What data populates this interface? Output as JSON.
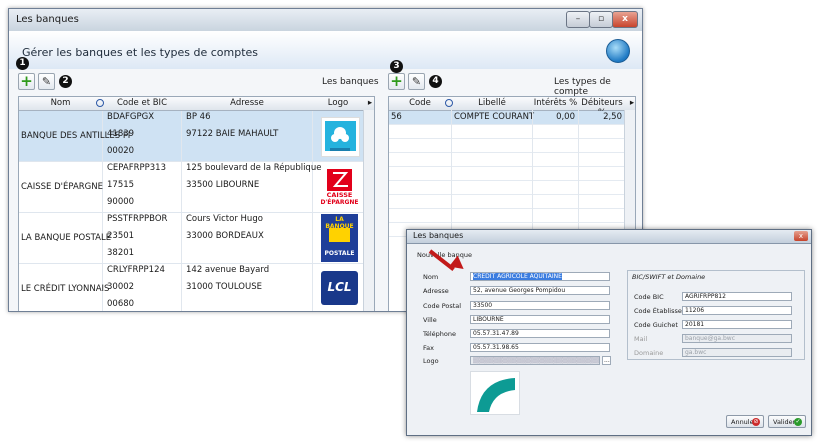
{
  "window": {
    "title": "Les banques",
    "header_title": "Gérer les banques et les types de comptes"
  },
  "titlebar_buttons": {
    "minimize": "–",
    "maximize": "▫",
    "close": "x"
  },
  "markers": [
    "1",
    "2",
    "3",
    "4"
  ],
  "banks": {
    "section_label": "Les banques",
    "columns": {
      "nom": "Nom",
      "code": "Code et BIC",
      "adresse": "Adresse",
      "logo": "Logo"
    },
    "rows": [
      {
        "nom": "BANQUE DES ANTILLES FI",
        "code": [
          "BDAFGPGX",
          "41839",
          "00020"
        ],
        "adresse": [
          "BP 46",
          "97122  BAIE MAHAULT"
        ],
        "logo": "BDAF"
      },
      {
        "nom": "CAISSE D'ÉPARGNE",
        "code": [
          "CEPAFRPP313",
          "17515",
          "90000"
        ],
        "adresse": [
          "125 boulevard de la République",
          "33500  LIBOURNE"
        ],
        "logo_text": [
          "CAISSE",
          "D'ÉPARGNE"
        ]
      },
      {
        "nom": "LA BANQUE POSTALE",
        "code": [
          "PSSTFRPPBOR",
          "23501",
          "38201"
        ],
        "adresse": [
          "Cours Victor Hugo",
          "33000  BORDEAUX"
        ],
        "logo_text": [
          "LA BANQUE",
          "POSTALE"
        ]
      },
      {
        "nom": "LE CRÉDIT LYONNAIS",
        "code": [
          "CRLYFRPP124",
          "30002",
          "00680"
        ],
        "adresse": [
          "142 avenue Bayard",
          "31000  TOULOUSE"
        ],
        "logo_text": [
          "LCL"
        ]
      }
    ]
  },
  "account_types": {
    "section_label": "Les types de compte",
    "columns": {
      "code": "Code",
      "libelle": "Libellé",
      "interets": "Intérêts %",
      "debiteurs": "Débiteurs %"
    },
    "rows": [
      {
        "code": "56",
        "libelle": "COMPTE COURANT",
        "interets": "0,00",
        "debiteurs": "2,50"
      }
    ]
  },
  "dialog": {
    "title": "Les banques",
    "subtitle": "Nouvelle banque",
    "labels": {
      "nom": "Nom",
      "adresse": "Adresse",
      "code_postal": "Code Postal",
      "ville": "Ville",
      "telephone": "Téléphone",
      "fax": "Fax",
      "logo": "Logo"
    },
    "values": {
      "nom": "CRÉDIT AGRICOLE AQUITAINE",
      "adresse": "52, avenue Georges Pompidou",
      "code_postal": "33500",
      "ville": "LIBOURNE",
      "telephone": "05.57.31.47.89",
      "fax": "05.57.31.98.65",
      "logo_btn": "..."
    },
    "group": {
      "title": "BIC/SWIFT et Domaine",
      "labels": {
        "bic": "Code BIC",
        "etab": "Code Établissement",
        "guichet": "Code Guichet",
        "mail": "Mail",
        "domaine": "Domaine"
      },
      "values": {
        "bic": "AGRIFRPP812",
        "etab": "11206",
        "guichet": "20181",
        "mail": "banque@ga.bwc",
        "domaine": "ga.bwc"
      }
    },
    "buttons": {
      "annuler": "Annuler",
      "valider": "Valider"
    }
  },
  "colors": {
    "accent": "#2f9a1b",
    "selection": "#cfe2f3",
    "arrow": "#c21a1a",
    "logo_teal": "#0d9b94"
  }
}
